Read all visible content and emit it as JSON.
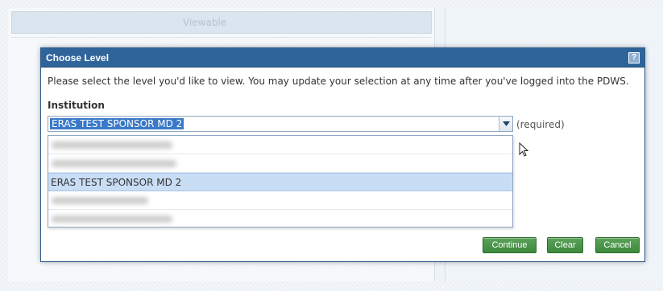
{
  "background": {
    "header_label": "Viewable"
  },
  "dialog": {
    "title": "Choose Level",
    "help_label": "?",
    "instructions": "Please select the level you'd like to view. You may update your selection at any time after you've logged into the PDWS.",
    "field": {
      "label": "Institution",
      "selected_value": "ERAS TEST SPONSOR MD 2",
      "required_text": "(required)"
    },
    "options": [
      {
        "label": "",
        "blurred": true
      },
      {
        "label": "",
        "blurred": true
      },
      {
        "label": "ERAS TEST SPONSOR MD 2",
        "blurred": false,
        "selected": true
      },
      {
        "label": "",
        "blurred": true
      },
      {
        "label": "",
        "blurred": true
      }
    ],
    "buttons": {
      "continue": "Continue",
      "clear": "Clear",
      "cancel": "Cancel"
    }
  },
  "colors": {
    "titlebar": "#2f649b",
    "button_green": "#4a954a",
    "selection_blue": "#3a79c7",
    "option_highlight": "#c9ddf5"
  },
  "icons": {
    "dropdown_arrow": "chevron-down-icon",
    "help": "help-icon",
    "cursor": "mouse-pointer-icon"
  }
}
